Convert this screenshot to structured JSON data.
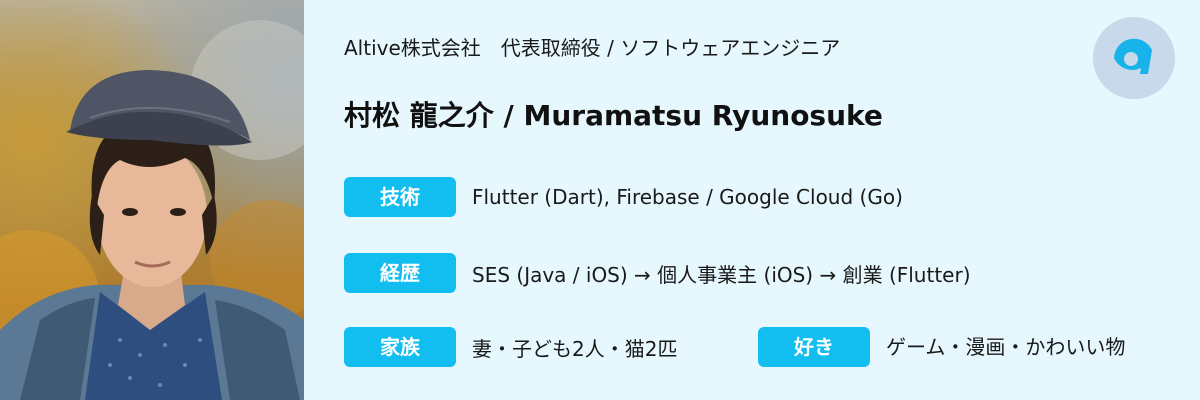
{
  "header": {
    "company_role": "Altive株式会社　代表取締役 / ソフトウェアエンジニア",
    "name": "村松 龍之介 / Muramatsu Ryunosuke"
  },
  "profile": {
    "skills_label": "技術",
    "skills_value": "Flutter (Dart), Firebase / Google Cloud (Go)",
    "career_label": "経歴",
    "career_value": "SES (Java / iOS) → 個人事業主 (iOS) → 創業 (Flutter)",
    "family_label": "家族",
    "family_value": "妻・子ども2人・猫2匹",
    "likes_label": "好き",
    "likes_value": "ゲーム・漫画・かわいい物"
  },
  "colors": {
    "background": "#e6f7fd",
    "badge": "#12bdf0",
    "logo_circle": "#c7d9ea",
    "logo_mark": "#17b3ea"
  },
  "icons": {
    "logo": "altive-logo-icon"
  }
}
